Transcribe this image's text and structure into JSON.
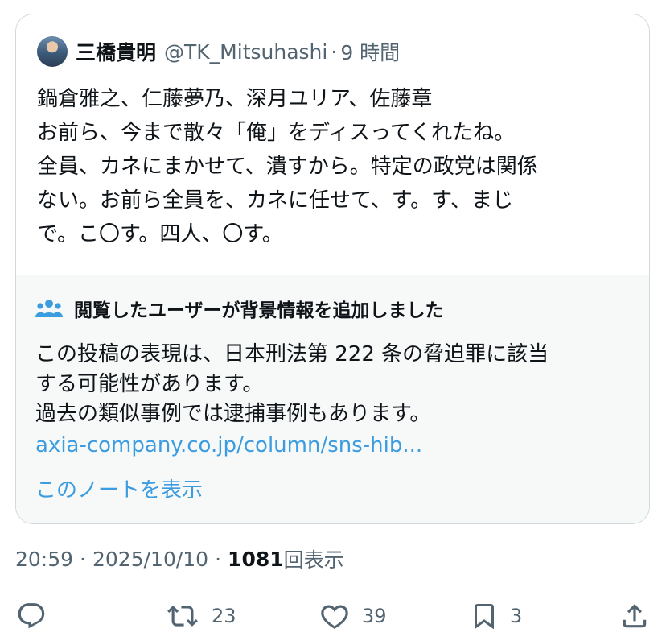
{
  "tweet": {
    "author": {
      "display_name": "三橋貴明",
      "handle": "@TK_Mitsuhashi",
      "separator": "·",
      "time_ago": "9 時間"
    },
    "lines": [
      "鍋倉雅之、仁藤夢乃、深月ユリア、佐藤章",
      "お前ら、今まで散々「俺」をディスってくれたね。",
      "全員、カネにまかせて、潰すから。特定の政党は関係",
      "ない。お前ら全員を、カネに任せて、す。す、まじ",
      "で。こ〇す。四人、〇す。"
    ]
  },
  "community_note": {
    "header": "閲覧したユーザーが背景情報を追加しました",
    "body_lines": [
      "この投稿の表現は、日本刑法第 222 条の脅迫罪に該当",
      "する可能性があります。",
      "過去の類似事例では逮捕事例もあります。"
    ],
    "link": "axia-company.co.jp/column/sns-hib...",
    "show_note": "このノートを表示"
  },
  "meta": {
    "time": "20:59",
    "separator": "·",
    "date": "2025/10/10",
    "views_count": "1081",
    "views_label": "回表示"
  },
  "actions": {
    "reply": {
      "icon": "reply-icon",
      "count": ""
    },
    "retweet": {
      "icon": "retweet-icon",
      "count": "23"
    },
    "like": {
      "icon": "heart-icon",
      "count": "39"
    },
    "bookmark": {
      "icon": "bookmark-icon",
      "count": "3"
    },
    "share": {
      "icon": "share-icon",
      "count": ""
    }
  },
  "colors": {
    "link": "#3b9ce0",
    "secondary_text": "#536471",
    "note_background": "#f7f9f9",
    "border": "#cfd9de"
  }
}
